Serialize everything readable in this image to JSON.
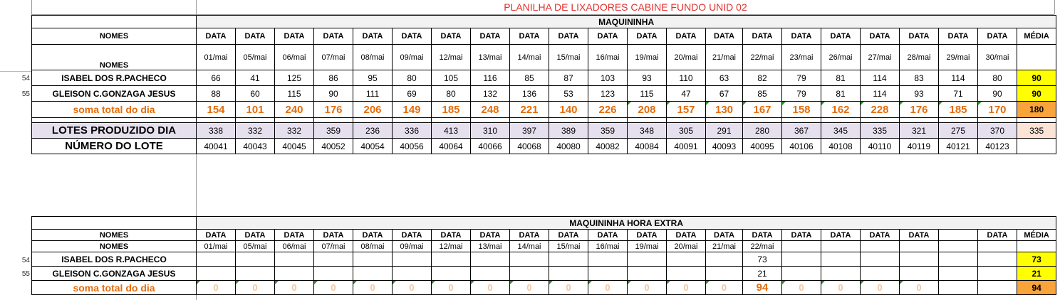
{
  "title": "PLANILHA DE LIXADORES CABINE FUNDO UNID 02",
  "top": {
    "section": "MAQUININHA",
    "nomes_header": "NOMES",
    "data_label": "DATA",
    "media_label": "MÉDIA",
    "dates": [
      "01/mai",
      "05/mai",
      "06/mai",
      "07/mai",
      "08/mai",
      "09/mai",
      "12/mai",
      "13/mai",
      "14/mai",
      "15/mai",
      "16/mai",
      "19/mai",
      "20/mai",
      "21/mai",
      "22/mai",
      "23/mai",
      "26/mai",
      "27/mai",
      "28/mai",
      "29/mai",
      "30/mai"
    ],
    "rows": [
      {
        "rownum": "54",
        "name": "ISABEL DOS R.PACHECO",
        "values": [
          "66",
          "41",
          "125",
          "86",
          "95",
          "80",
          "105",
          "116",
          "85",
          "87",
          "103",
          "93",
          "110",
          "63",
          "82",
          "79",
          "81",
          "114",
          "83",
          "114",
          "80"
        ],
        "media": "90"
      },
      {
        "rownum": "55",
        "name": "GLEISON C.GONZAGA JESUS",
        "values": [
          "88",
          "60",
          "115",
          "90",
          "111",
          "69",
          "80",
          "132",
          "136",
          "53",
          "123",
          "115",
          "47",
          "67",
          "85",
          "79",
          "81",
          "114",
          "93",
          "71",
          "90"
        ],
        "media": "90"
      }
    ],
    "soma": {
      "label": "soma total  do dia",
      "values": [
        "154",
        "101",
        "240",
        "176",
        "206",
        "149",
        "185",
        "248",
        "221",
        "140",
        "226",
        "208",
        "157",
        "130",
        "167",
        "158",
        "162",
        "228",
        "176",
        "185",
        "170"
      ],
      "media": "180"
    },
    "lotes": {
      "label": "LOTES PRODUZIDO DIA",
      "values": [
        "338",
        "332",
        "332",
        "359",
        "236",
        "336",
        "413",
        "310",
        "397",
        "389",
        "359",
        "348",
        "305",
        "291",
        "280",
        "367",
        "345",
        "335",
        "321",
        "275",
        "370"
      ],
      "media": "335"
    },
    "numero": {
      "label": "NÚMERO DO LOTE",
      "values": [
        "40041",
        "40043",
        "40045",
        "40052",
        "40054",
        "40056",
        "40064",
        "40066",
        "40068",
        "40080",
        "40082",
        "40084",
        "40091",
        "40093",
        "40095",
        "40106",
        "40108",
        "40110",
        "40119",
        "40121",
        "40123"
      ]
    }
  },
  "bottom": {
    "section": "MAQUININHA HORA EXTRA",
    "nomes_header": "NOMES",
    "data_label": "DATA",
    "media_label": "MÉDIA",
    "dates": [
      "01/mai",
      "05/mai",
      "06/mai",
      "07/mai",
      "08/mai",
      "09/mai",
      "12/mai",
      "13/mai",
      "14/mai",
      "15/mai",
      "16/mai",
      "19/mai",
      "20/mai",
      "21/mai",
      "22/mai"
    ],
    "rows": [
      {
        "rownum": "54",
        "name": "ISABEL DOS R.PACHECO",
        "value_col15": "73",
        "media": "73"
      },
      {
        "rownum": "55",
        "name": "GLEISON C.GONZAGA JESUS",
        "value_col15": "21",
        "media": "21"
      }
    ],
    "soma": {
      "label": "soma total  do dia",
      "values": [
        "0",
        "0",
        "0",
        "0",
        "0",
        "0",
        "0",
        "0",
        "0",
        "0",
        "0",
        "0",
        "0",
        "0",
        "94",
        "0",
        "0",
        "0",
        "0"
      ],
      "media": "94"
    }
  },
  "colors": {
    "title_red": "#e3302d",
    "orange_text": "#e46c0a",
    "yellow": "#ffff00",
    "orange_fill": "#f9a33b",
    "lotes_fill": "#e6e0ee"
  }
}
